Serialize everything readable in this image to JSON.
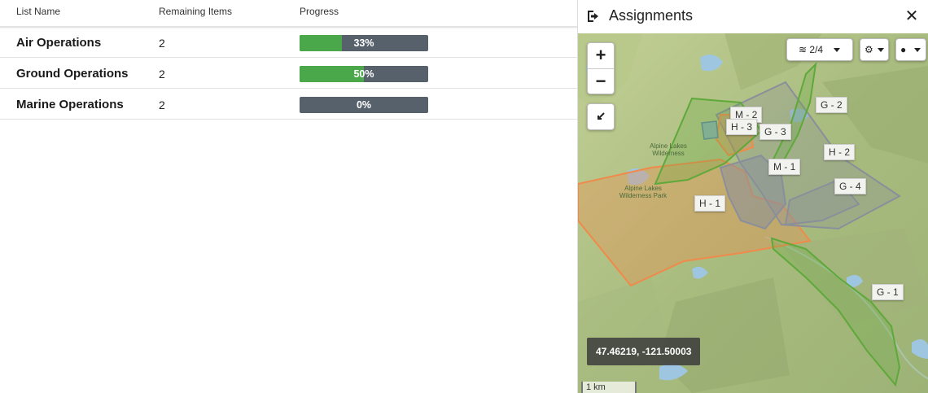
{
  "list": {
    "headers": {
      "name": "List Name",
      "remaining": "Remaining Items",
      "progress": "Progress"
    },
    "rows": [
      {
        "name": "Air Operations",
        "remaining": "2",
        "progress": 0.33,
        "progress_label": "33%"
      },
      {
        "name": "Ground Operations",
        "remaining": "2",
        "progress": 0.5,
        "progress_label": "50%"
      },
      {
        "name": "Marine Operations",
        "remaining": "2",
        "progress": 0.0,
        "progress_label": "0%"
      }
    ]
  },
  "panel": {
    "title": "Assignments",
    "map": {
      "layers_label": "2/4",
      "coordinates": "47.46219, -121.50003",
      "scale_label": "1 km",
      "place_labels": [
        "Alpine Lakes Wilderness",
        "Alpine Lakes Wilderness Park"
      ],
      "assignment_labels": [
        "M - 2",
        "H - 3",
        "G - 3",
        "G - 2",
        "H - 2",
        "M - 1",
        "G - 4",
        "H - 1",
        "G - 1"
      ]
    }
  },
  "colors": {
    "progress_fill": "#4aa84a",
    "progress_track": "#56616c",
    "ground_poly": "#5fa83a",
    "heli_poly": "#f08a4b",
    "marine_poly": "#8a8f9a"
  }
}
